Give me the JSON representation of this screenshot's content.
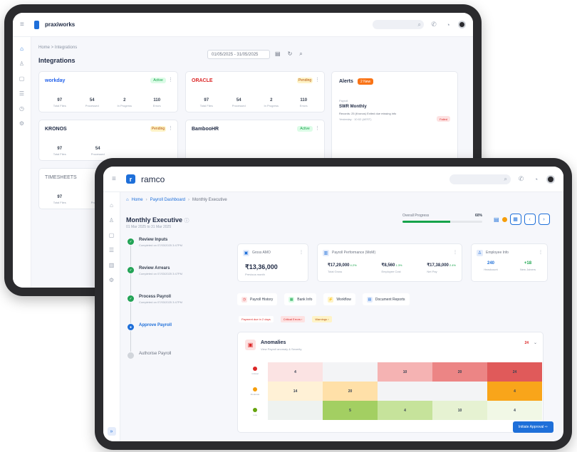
{
  "back": {
    "app_name": "praxiworks",
    "breadcrumb": "Home  >  Integrations",
    "page_title": "Integrations",
    "date_range": "01/05/2025 - 31/05/2025",
    "cards": [
      {
        "brand": "workday",
        "status": "Active",
        "stats": [
          {
            "v": "97",
            "l": "Total Files"
          },
          {
            "v": "54",
            "l": "Processed"
          },
          {
            "v": "2",
            "l": "In Progress"
          },
          {
            "v": "110",
            "l": "Errors"
          }
        ]
      },
      {
        "brand": "ORACLE",
        "status": "Pending",
        "stats": [
          {
            "v": "97",
            "l": "Total Files"
          },
          {
            "v": "54",
            "l": "Processed"
          },
          {
            "v": "2",
            "l": "In Progress"
          },
          {
            "v": "110",
            "l": "Errors"
          }
        ]
      },
      {
        "brand": "KRONOS",
        "status": "Pending",
        "stats": [
          {
            "v": "97",
            "l": "Total Files"
          },
          {
            "v": "54",
            "l": "Processed"
          }
        ]
      },
      {
        "brand": "BambooHR",
        "status": "Active",
        "stats": []
      },
      {
        "brand": "TIMESHEETS",
        "status": "",
        "stats": [
          {
            "v": "97",
            "l": "Total Files"
          },
          {
            "v": "54",
            "l": "Processed"
          }
        ]
      }
    ],
    "alerts": {
      "title": "Alerts",
      "badge": "2 New",
      "kicker": "Payroll",
      "item_title": "SWR Monthly",
      "item_desc": "Records: 25 (Kronos) Exited due missing info",
      "item_time": "Yesterday  ·  10:02 (AEST)",
      "item_tag": "Failed"
    }
  },
  "front": {
    "app_name": "ramco",
    "breadcrumb": [
      "Home",
      "Payroll Dashboard",
      "Monthly Executive"
    ],
    "title": "Monthly Executive",
    "subtitle": "01 Mar 2025 to 31 Mar 2025",
    "progress_label": "Overall Progress",
    "progress_value": "60%",
    "progress_fraction": 0.6,
    "steps": [
      {
        "title": "Review Inputs",
        "sub": "Completed on 07/03/2025 3:47PM",
        "state": "done"
      },
      {
        "title": "Review Arrears",
        "sub": "Completed on 07/03/2025 3:47PM",
        "state": "done"
      },
      {
        "title": "Process Payroll",
        "sub": "Completed on 07/03/2025 3:47PM",
        "state": "done"
      },
      {
        "title": "Approve Payroll",
        "sub": "",
        "state": "current"
      },
      {
        "title": "Authorise Payroll",
        "sub": "",
        "state": "todo"
      }
    ],
    "gross_card": {
      "title": "Gross AMO",
      "value": "₹13,36,000",
      "caption": "Previous month"
    },
    "perf_card": {
      "title": "Payroll Performance (MoM)",
      "cols": [
        {
          "v": "₹17,29,000",
          "up": "4.2%",
          "l": "Total Gross"
        },
        {
          "v": "₹8,560",
          "up": "1.3%",
          "l": "Employee Cost"
        },
        {
          "v": "₹17,38,000",
          "up": "2.4%",
          "l": "Net Pay"
        }
      ]
    },
    "emp_card": {
      "title": "Employee Info",
      "cols": [
        {
          "v": "240",
          "l": "Headcount"
        },
        {
          "v": "+18",
          "l": "New Joiners"
        }
      ]
    },
    "actions": [
      {
        "label": "Payroll History",
        "icon": "history-icon",
        "bg": "#fde7e7",
        "fg": "#dc2626"
      },
      {
        "label": "Bank Info",
        "icon": "bank-icon",
        "bg": "#dcfce7",
        "fg": "#16a34a"
      },
      {
        "label": "Workflow",
        "icon": "workflow-icon",
        "bg": "#fef3c7",
        "fg": "#d97706"
      },
      {
        "label": "Document Reports",
        "icon": "document-icon",
        "bg": "#e4ecfb",
        "fg": "#1e6fd9"
      }
    ],
    "chips": [
      {
        "label": "Payment due in 2 days",
        "bg": "#ffffff",
        "fg": "#dc2626"
      },
      {
        "label": "Critical Errors  ›",
        "bg": "#fde2e2",
        "fg": "#dc2626"
      },
      {
        "label": "Warnings  ›",
        "bg": "#fef3c7",
        "fg": "#b45309"
      }
    ],
    "anomalies": {
      "title": "Anomalies",
      "subtitle": "View Payroll anomaly & Severity",
      "count": "24",
      "legend": [
        {
          "label": "Critical",
          "color": "#dc2626"
        },
        {
          "label": "Moderate",
          "color": "#f59e0b"
        },
        {
          "label": "Low",
          "color": "#65a30d"
        }
      ],
      "rows": [
        [
          {
            "v": "4",
            "c": "#fbe3e3"
          },
          {
            "v": "",
            "c": "#f3f4f6"
          },
          {
            "v": "10",
            "c": "#f5b3b3"
          },
          {
            "v": "20",
            "c": "#ec8585"
          },
          {
            "v": "24",
            "c": "#e05a5a"
          }
        ],
        [
          {
            "v": "14",
            "c": "#fff1d6"
          },
          {
            "v": "20",
            "c": "#ffe0a8"
          },
          {
            "v": "",
            "c": "#f3f4f6"
          },
          {
            "v": "",
            "c": "#f3f4f6"
          },
          {
            "v": "4",
            "c": "#f9a51a"
          }
        ],
        [
          {
            "v": "",
            "c": "#eef2f0"
          },
          {
            "v": "5",
            "c": "#a3cf62"
          },
          {
            "v": "4",
            "c": "#c6e39b"
          },
          {
            "v": "10",
            "c": "#e6f2d2"
          },
          {
            "v": "4",
            "c": "#f1f8e6"
          }
        ]
      ]
    },
    "cta_label": "Initiate Approval  ⇨"
  }
}
